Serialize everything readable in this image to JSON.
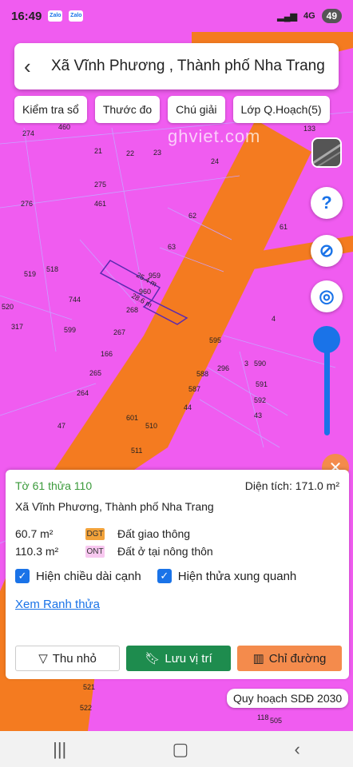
{
  "status": {
    "time": "16:49",
    "apps": [
      "Zalo",
      "Zalo"
    ],
    "net": "4G",
    "battery": "49"
  },
  "header": {
    "title": "Xã Vĩnh Phương , Thành phố Nha Trang"
  },
  "chips": [
    "Kiểm tra sổ",
    "Thước đo",
    "Chú giải",
    "Lớp Q.Hoạch(5)"
  ],
  "watermark": "ghviet.com",
  "map_labels": [
    "274",
    "460",
    "21",
    "22",
    "23",
    "133",
    "275",
    "24",
    "276",
    "461",
    "62",
    "61",
    "519",
    "518",
    "63",
    "959",
    "960",
    "744",
    "520",
    "268",
    "317",
    "599",
    "267",
    "4",
    "166",
    "595",
    "265",
    "296",
    "3",
    "590",
    "588",
    "264",
    "587",
    "591",
    "592",
    "44",
    "47",
    "601",
    "510",
    "43",
    "511",
    "521",
    "522",
    "118",
    "505",
    "25.4 m",
    "28.6 m"
  ],
  "panel": {
    "parcel": "Tờ 61 thửa 110",
    "area_label": "Diện tích: 171.0 m²",
    "address": "Xã Vĩnh Phương, Thành phố Nha Trang",
    "uses": [
      {
        "amount": "60.7 m²",
        "code": "DGT",
        "desc": "Đất giao thông"
      },
      {
        "amount": "110.3 m²",
        "code": "ONT",
        "desc": "Đất ở tại nông thôn"
      }
    ],
    "check1": "Hiện chiều dài cạnh",
    "check2": "Hiện thửa xung quanh",
    "link": "Xem Ranh thửa",
    "btn_shrink": "Thu nhỏ",
    "btn_save": "Lưu vị trí",
    "btn_dir": "Chỉ đường"
  },
  "plan_badge": "Quy hoạch SDĐ 2030",
  "colors": {
    "map_pink": "#f05cf0",
    "road_orange": "#f47b20",
    "accent": "#1a73e8",
    "save_green": "#1e8c4e"
  }
}
